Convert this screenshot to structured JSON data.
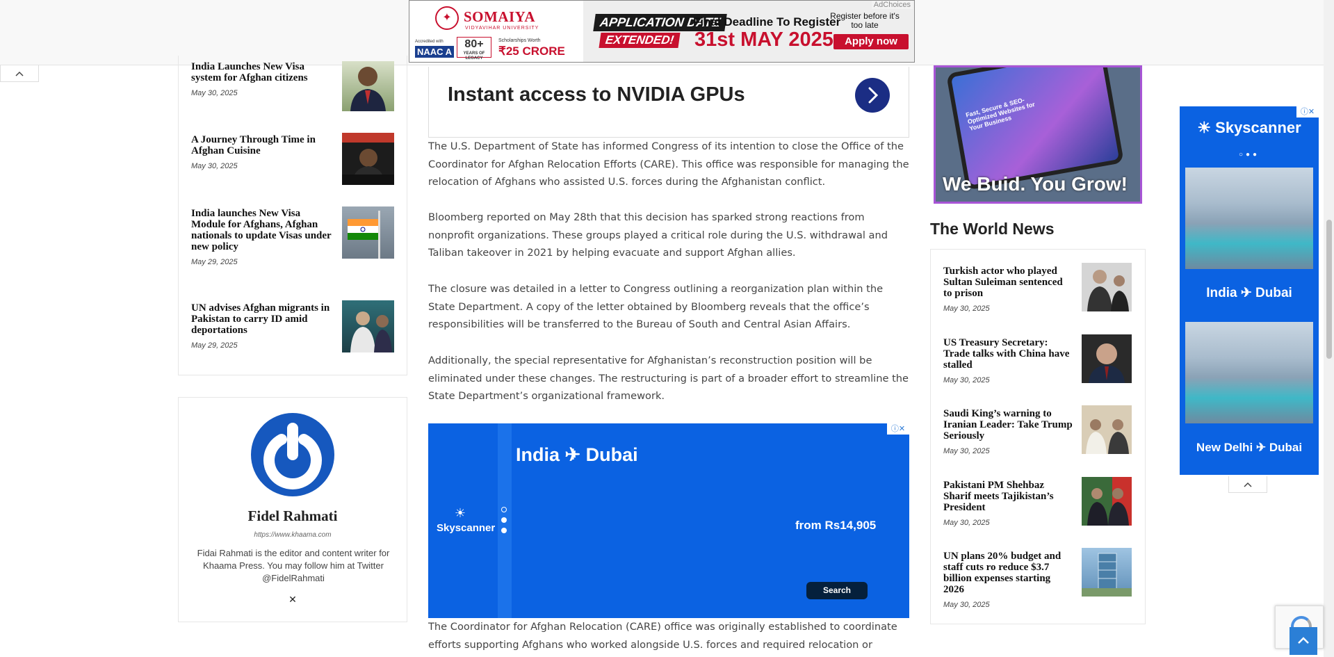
{
  "top_ad": {
    "brand": "SOMAIYA",
    "brand_sub": "VIDYAVIHAR UNIVERSITY",
    "accredited": "Accredited with",
    "naac": "NAAC A",
    "years": "80+",
    "years_sub": "YEARS OF LEGACY",
    "scholarships": "Scholarships Worth",
    "crore": "₹25 CRORE",
    "app_date": "APPLICATION DATE",
    "extended": "EXTENDED!",
    "final_deadline": "Final Deadline To Register",
    "date": "31st MAY 2025",
    "register_note": "Register before it's too late",
    "apply": "Apply now",
    "adchoices": "AdChoices"
  },
  "left_posts": [
    {
      "title": "India Launches New Visa system for Afghan citizens",
      "date": "May 30, 2025"
    },
    {
      "title": "A Journey Through Time in Afghan Cuisine",
      "date": "May 30, 2025"
    },
    {
      "title": "India launches New Visa Module for Afghans, Afghan nationals to update Visas under new policy",
      "date": "May 29, 2025"
    },
    {
      "title": "UN advises Afghan migrants in Pakistan to carry ID amid deportations",
      "date": "May 29, 2025"
    }
  ],
  "author": {
    "name": "Fidel Rahmati",
    "url": "https://www.khaama.com",
    "bio": "Fidai Rahmati is the editor and content writer for Khaama Press. You may follow him at Twitter @FidelRahmati",
    "social_icon": "x-icon"
  },
  "nvidia_ad": {
    "text": "Instant access to NVIDIA GPUs"
  },
  "article": {
    "paragraphs": [
      "The U.S. Department of State has informed Congress of its intention to close the Office of the Coordinator for Afghan Relocation Efforts (CARE). This office was responsible for managing the relocation of Afghans who assisted U.S. forces during the Afghanistan conflict.",
      "Bloomberg reported on May 28th that this decision has sparked strong reactions from nonprofit organizations. These groups played a critical role during the U.S. withdrawal and Taliban takeover in 2021 by helping evacuate and support Afghan allies.",
      "The closure was detailed in a letter to Congress outlining a reorganization plan within the State Department. A copy of the letter obtained by Bloomberg reveals that the office’s responsibilities will be transferred to the Bureau of South and Central Asian Affairs.",
      "Additionally, the special representative for Afghanistan’s reconstruction position will be eliminated under these changes. The restructuring is part of a broader effort to streamline the State Department’s organizational framework.",
      "The Coordinator for Afghan Relocation (CARE) office was originally established to coordinate efforts supporting Afghans who worked alongside U.S. forces and required relocation or protection."
    ]
  },
  "skyscanner_ad": {
    "destination": "India ✈ Dubai",
    "logo": "Skyscanner",
    "price": "from Rs14,905",
    "search": "Search"
  },
  "web_ad": {
    "headline": "Fast, Secure & SEO-Optimized Websites for Your Business",
    "tagline": "We Buid. You Grow!"
  },
  "world_news": {
    "title": "The World News",
    "posts": [
      {
        "title": "Turkish actor who played Sultan Suleiman sentenced to prison",
        "date": "May 30, 2025"
      },
      {
        "title": "US Treasury Secretary: Trade talks with China have stalled",
        "date": "May 30, 2025"
      },
      {
        "title": "Saudi King’s warning to Iranian Leader: Take Trump Seriously",
        "date": "May 30, 2025"
      },
      {
        "title": "Pakistani PM Shehbaz Sharif meets Tajikistan’s President",
        "date": "May 30, 2025"
      },
      {
        "title": "UN plans 20% budget and staff cuts ro reduce $3.7 billion expenses starting 2026",
        "date": "May 30, 2025"
      }
    ]
  },
  "skyscanner_side": {
    "logo": "Skyscanner",
    "dest1": "India ✈ Dubai",
    "dest2": "New Delhi ✈ Dubai"
  },
  "colors": {
    "accent_blue": "#0b62e2",
    "brand_red": "#c8102e",
    "author_blue": "#1658be"
  }
}
